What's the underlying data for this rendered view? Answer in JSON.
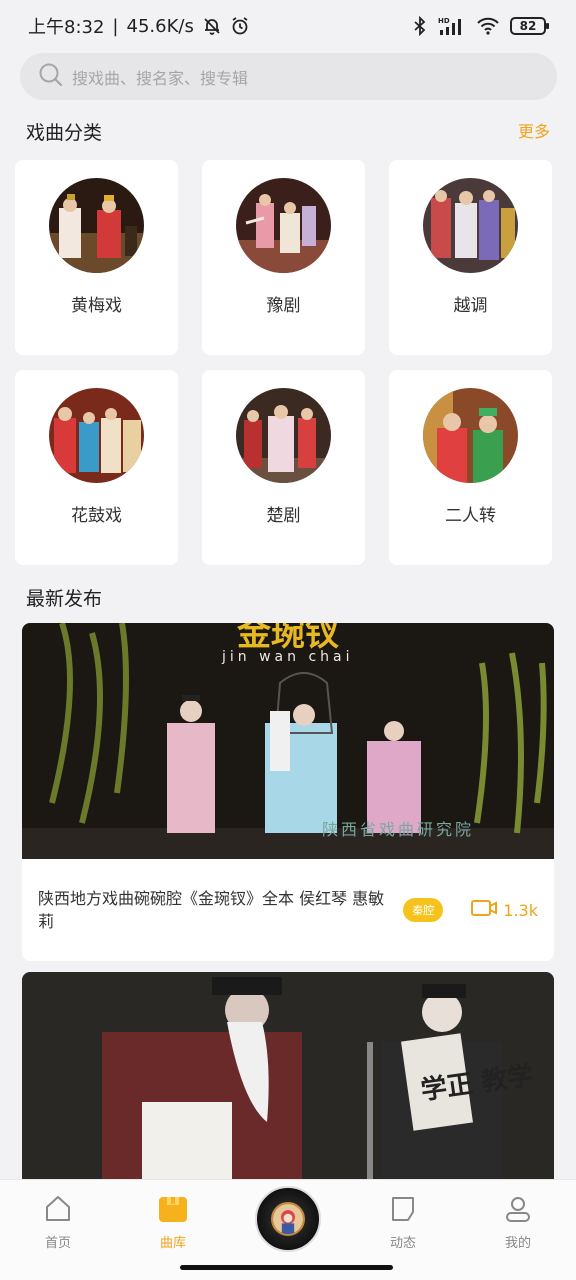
{
  "status": {
    "time": "上午8:32",
    "sep": "|",
    "speed": "45.6K/s",
    "battery": "82",
    "hd": "HD"
  },
  "search": {
    "placeholder": "搜戏曲、搜名家、搜专辑"
  },
  "categories": {
    "title": "戏曲分类",
    "more": "更多",
    "items": [
      {
        "label": "黄梅戏"
      },
      {
        "label": "豫剧"
      },
      {
        "label": "越调"
      },
      {
        "label": "花鼓戏"
      },
      {
        "label": "楚剧"
      },
      {
        "label": "二人转"
      }
    ]
  },
  "latest": {
    "title": "最新发布",
    "items": [
      {
        "banner_title": "金琬钗",
        "banner_pinyin": "jin wan chai",
        "banner_watermark": "陕西省戏曲研究院",
        "title": "陕西地方戏曲碗碗腔《金琬钗》全本 侯红琴 惠敏莉",
        "tag": "秦腔",
        "views": "1.3k"
      },
      {
        "banner_sign": "学正 教学"
      }
    ]
  },
  "nav": {
    "items": [
      {
        "label": "首页"
      },
      {
        "label": "曲库"
      },
      {
        "label": "动态"
      },
      {
        "label": "我的"
      }
    ],
    "active": "曲库"
  },
  "colors": {
    "accent": "#f0a41b",
    "tag_bg": "#f6c21c",
    "background": "#f2f2f4"
  }
}
